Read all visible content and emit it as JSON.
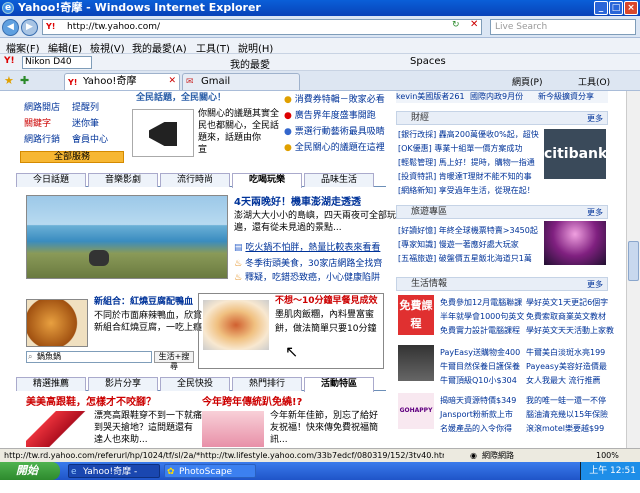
{
  "window": {
    "title": "Yahoo!奇摩 - Windows Internet Explorer"
  },
  "address": {
    "url": "http://tw.yahoo.com/",
    "search_placeholder": "Live Search"
  },
  "menu": [
    "檔案(F)",
    "編輯(E)",
    "檢視(V)",
    "我的最愛(A)",
    "工具(T)",
    "說明(H)"
  ],
  "toolbar": {
    "search_text": "Nikon D40",
    "favorites": "我的最愛",
    "spaces": "Spaces",
    "page": "網頁(P)",
    "tools": "工具(O)"
  },
  "tabs": [
    {
      "label": "Yahoo!奇摩"
    },
    {
      "label": "Gmail"
    }
  ],
  "leftnav": {
    "rows": [
      [
        "網路開店",
        "提醒列"
      ],
      [
        "關鍵字",
        "迷你筆"
      ],
      [
        "網路行銷",
        "會員中心"
      ]
    ],
    "all_services": "全部服務"
  },
  "promo": {
    "title": "全民話題，全民關心！",
    "body": [
      "你關心的議題其實全",
      "民也都關心，全民話",
      "題來，話題由你",
      "宣"
    ]
  },
  "promo_links": [
    "消費券特輯－敗家必看",
    "廣告界年度盛事開跑",
    "票選行動藝術最具吸睛",
    "全民關心的議題在這裡"
  ],
  "center_tabs": [
    "今日話題",
    "音樂影劇",
    "流行時尚",
    "吃喝玩樂",
    "品味生活"
  ],
  "feature": {
    "headline": "4天兩晚好！機車澎湖走透透",
    "desc": [
      "澎湖大大小小的島嶼，四天兩夜可全部玩",
      "遍，還有從未見過的景點..."
    ],
    "links": [
      "吃火鍋不怕胖，熱量比較表來看看",
      "冬季街頭美食，30家店網路全找齊",
      "釋疑，吃錯恐致癌，小心健康陷阱"
    ]
  },
  "sub1": {
    "title": "新組合：紅燒豆腐配鴨血",
    "body": [
      "不同於市面麻辣鴨血，欣賞",
      "新組合紅燒豆腐，一吃上癮"
    ],
    "search_value": "鍋魚鍋",
    "search_btn": "生活+搜尋"
  },
  "sub2": {
    "title": "不想～10分鐘早餐見成效",
    "body": [
      "墨肌肉飯糰，內料豐富蜜",
      "餅，做法簡單只要10分鐘"
    ]
  },
  "bottom_tabs": [
    "精選推薦",
    "影片分享",
    "全民快投",
    "熱門排行",
    "活動特區"
  ],
  "bottom_left": {
    "title": "美美高跟鞋，怎樣才不咬腳？",
    "body": [
      "漂亮高跟鞋穿不到一下就痛",
      "到哭天搶地？這問題還有",
      "達人也來助..."
    ]
  },
  "bottom_right": {
    "title": "今年跨年傳統趴免繞!?",
    "body": [
      "今年新年佳節，別忘了給好",
      "友祝福！快來傳免費祝福簡",
      "訊..."
    ]
  },
  "right_top": [
    "kevin美國版者261",
    "國際内政9月份",
    "新今級擴資分享"
  ],
  "stock": {
    "header": "財經",
    "more": "更多",
    "lines": [
      "[銀行改採] 轟高200萬優收0%起，超快",
      "[OK優惠] 專業十組單一價方案成功",
      "[輕鬆管理] 馬上好！提時，購物一指通",
      "[投資特訊] 肯暖達T理財不能不知的事",
      "[網絡新知] 享受過年生活，從現在起！"
    ],
    "ad_brand": "citibank"
  },
  "travel": {
    "header": "旅遊專區",
    "more": "更多",
    "lines": [
      "[好讀好憶] 年終全球機票特賣>3450起",
      "[專家知識] 慢遊一著應好處大玩家",
      "[五福旅遊] 破盤價五星飯北海道只1萬"
    ]
  },
  "life": {
    "header": "生活情報",
    "more": "更多",
    "ad_text": "免費課程",
    "rows": [
      [
        "免費參加12月電腦聯課",
        "學好英文1天更記6個字"
      ],
      [
        "半年就學會1000句英文",
        "免費索取商業英文教材"
      ],
      [
        "免費實力設計電腦課程",
        "學好英文天天活動上家教"
      ]
    ],
    "rows2": [
      [
        "PayEasy送購物金400",
        "牛爾美白淡斑水亮199"
      ],
      [
        "牛爾目然保養日護保養",
        "Payeasy美容好造價最"
      ],
      [
        "牛爾頂級Q10小$304",
        "女人我最大 流行推薦"
      ]
    ],
    "rows3": [
      [
        "揭暗天資源特價$349",
        "我的唯一蛙一還一不停"
      ],
      [
        "Jansport粉新款上市",
        "腦油清充幾以15年保險"
      ],
      [
        "名媛產品的入令你得",
        "滾滾motel樂要越$99"
      ]
    ],
    "ad3": "GOHAPPY"
  },
  "status": {
    "text": "http://tw.rd.yahoo.com/referurl/hp/1024/tf/sl/2a/*http://tw.lifestyle.yahoo.com/33b7edcf/080319/152/3tv40.html",
    "zone": "網際網路",
    "zoom": "100%"
  },
  "taskbar": {
    "start": "開始",
    "items": [
      "Yahoo!奇摩 - Windo...",
      "PhotoScape"
    ],
    "clock": "上午 12:51"
  },
  "colors": {
    "titlebar": "#0a5fd8",
    "accent": "#ff6600",
    "taskbar": "#2a6ae0"
  }
}
